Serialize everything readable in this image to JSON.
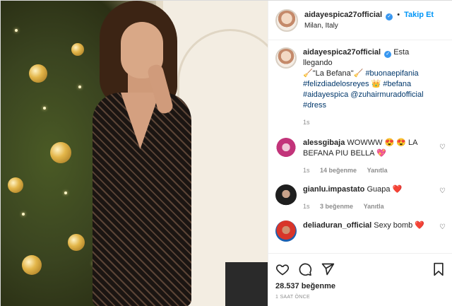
{
  "post": {
    "username": "aidayespica27official",
    "follow_label": "Takip Et",
    "location": "Milan, Italy",
    "caption": {
      "username": "aidayespica27official",
      "text_1": "Esta llegando",
      "text_2": "\"La Befana\"",
      "hashtags_1": "#buonaepifania",
      "hashtags_2": "#felizdiadelosreyes",
      "hashtags_3": "#befana",
      "hashtags_4": "#aidayespica",
      "mention": "@zuhairmuradofficial",
      "hashtags_5": "#dress",
      "time": "1s"
    },
    "comments": [
      {
        "username": "alessgibaja",
        "text": "WOWWW 😍 😍 LA BEFANA PIU BELLA 💖",
        "time": "1s",
        "likes": "14 beğenme",
        "reply": "Yanıtla"
      },
      {
        "username": "gianlu.impastato",
        "text": "Guapa ❤️",
        "time": "1s",
        "likes": "3 beğenme",
        "reply": "Yanıtla"
      },
      {
        "username": "deliaduran_official",
        "text": "Sexy bomb ❤️"
      }
    ],
    "like_count": "28.537 beğenme",
    "posted_ago": "1 SAAT ÖNCE"
  },
  "icons": [
    "heart-icon",
    "comment-icon",
    "share-icon",
    "bookmark-icon",
    "verified-badge-icon"
  ]
}
